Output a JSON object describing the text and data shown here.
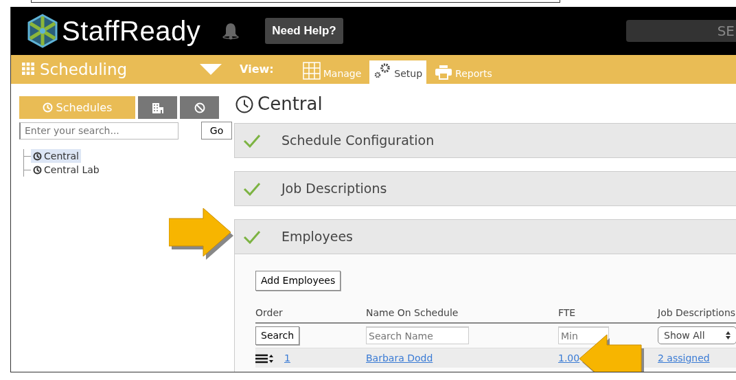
{
  "header": {
    "logo_text": "StaffReady",
    "help_button": "Need Help?",
    "search": {
      "placeholder": "SE"
    }
  },
  "module_bar": {
    "title": "Scheduling",
    "view_label": "View:",
    "tabs": [
      {
        "kind": "grid",
        "label": "Manage",
        "selected": false
      },
      {
        "kind": "gears",
        "label": "Setup",
        "selected": true
      },
      {
        "kind": "printer",
        "label": "Reports",
        "selected": false
      }
    ]
  },
  "sidebar": {
    "tabs": [
      {
        "kind": "clock",
        "label": "Schedules",
        "selected": true
      },
      {
        "kind": "building",
        "selected": false
      },
      {
        "kind": "ban",
        "selected": false
      }
    ],
    "search": {
      "placeholder": "Enter your search..."
    },
    "go_button": "Go",
    "tree": [
      {
        "label": "Central",
        "selected": true
      },
      {
        "label": "Central Lab",
        "selected": false
      }
    ]
  },
  "main": {
    "title": "Central",
    "sections": [
      {
        "title": "Schedule Configuration",
        "complete": true,
        "expanded": false
      },
      {
        "title": "Job Descriptions",
        "complete": true,
        "expanded": false
      },
      {
        "title": "Employees",
        "complete": true,
        "expanded": true
      }
    ],
    "employees": {
      "add_button": "Add Employees",
      "columns": [
        "Order",
        "Name On Schedule",
        "FTE",
        "Job Descriptions"
      ],
      "filters": {
        "order_button": "Search",
        "name_placeholder": "Search Name",
        "fte_placeholder": "Min",
        "job_select": "Show All"
      },
      "rows": [
        {
          "order": "1",
          "name": "Barbara Dodd",
          "fte": "1.00",
          "job_descriptions": "2 assigned"
        }
      ]
    }
  },
  "annotations": [
    {
      "kind": "right-arrow"
    },
    {
      "kind": "left-arrow"
    }
  ]
}
